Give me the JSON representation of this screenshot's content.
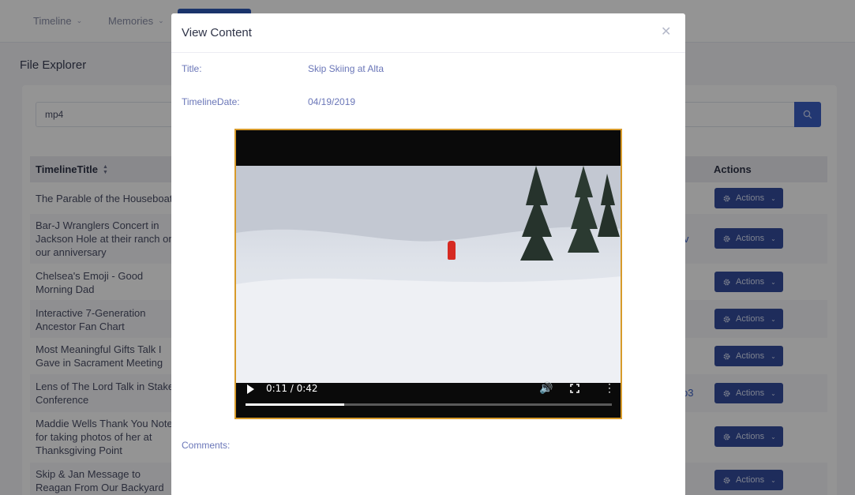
{
  "nav": {
    "items": [
      {
        "label": "Timeline"
      },
      {
        "label": "Memories"
      }
    ]
  },
  "page": {
    "title": "File Explorer"
  },
  "search": {
    "value": "mp4"
  },
  "table": {
    "headers": {
      "title": "TimelineTitle",
      "actions": "Actions"
    },
    "rows": [
      {
        "title": "The Parable of the Houseboat",
        "link": "",
        "action": "Actions"
      },
      {
        "title": "Bar-J Wranglers Concert in Jackson Hole at their ranch on our anniversary",
        "link": "v",
        "action": "Actions"
      },
      {
        "title": "Chelsea's Emoji - Good Morning Dad",
        "link": "",
        "action": "Actions"
      },
      {
        "title": "Interactive 7-Generation Ancestor Fan Chart",
        "link": "",
        "action": "Actions"
      },
      {
        "title": "Most Meaningful Gifts Talk I Gave in Sacrament Meeting",
        "link": "",
        "action": "Actions"
      },
      {
        "title": "Lens of The Lord Talk in Stake Conference",
        "link": "p3",
        "action": "Actions"
      },
      {
        "title": "Maddie Wells Thank You Note for taking photos of her at Thanksgiving Point",
        "link": "",
        "action": "Actions"
      },
      {
        "title": "Skip & Jan Message to Reagan From Our Backyard",
        "link": "",
        "action": "Actions"
      }
    ]
  },
  "modal": {
    "title": "View Content",
    "title_label": "Title:",
    "title_value": "Skip Skiing at Alta",
    "date_label": "TimelineDate:",
    "date_value": "04/19/2019",
    "comments_label": "Comments:",
    "video": {
      "time": "0:11 / 0:42",
      "progress": 0.27
    }
  },
  "colors": {
    "accent": "#3c60c5",
    "action_button": "#344d9e",
    "video_border": "#d79a2a"
  },
  "icons": [
    "chevron-down-icon",
    "search-icon",
    "sort-icon",
    "gear-icon",
    "close-icon",
    "play-icon",
    "volume-icon",
    "fullscreen-icon",
    "more-vert-icon"
  ]
}
